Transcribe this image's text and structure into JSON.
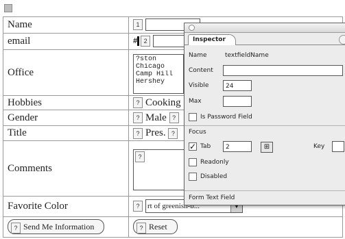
{
  "form": {
    "rows": [
      {
        "label": "Name"
      },
      {
        "label": "email"
      },
      {
        "label": "Office"
      },
      {
        "label": "Hobbies"
      },
      {
        "label": "Gender"
      },
      {
        "label": "Title"
      },
      {
        "label": "Comments"
      },
      {
        "label": "Favorite Color"
      }
    ],
    "field_icon": "?",
    "name_field_icon": "1",
    "email_field_icon": "2",
    "email_marker": "#",
    "office_options": [
      "?ston",
      "Chicago",
      "Camp Hill",
      "Hershey"
    ],
    "hobbies_value": "Cooking",
    "gender_value": "Male",
    "title_value": "Pres.",
    "color_value": "rt of greenish-b...",
    "send_button": "Send Me Information",
    "reset_button": "Reset"
  },
  "inspector": {
    "tab_label": "Inspector",
    "name_label": "Name",
    "name_value": "textfieldName",
    "content_label": "Content",
    "content_value": "",
    "visible_label": "Visible",
    "visible_value": "24",
    "max_label": "Max",
    "max_value": "",
    "password_label": "Is Password Field",
    "password_checked": false,
    "focus_label": "Focus",
    "tab_check_label": "Tab",
    "tab_checked": true,
    "tab_value": "2",
    "key_label": "Key",
    "readonly_label": "Readonly",
    "readonly_checked": false,
    "disabled_label": "Disabled",
    "disabled_checked": false,
    "footer_label": "Form Text Field"
  }
}
